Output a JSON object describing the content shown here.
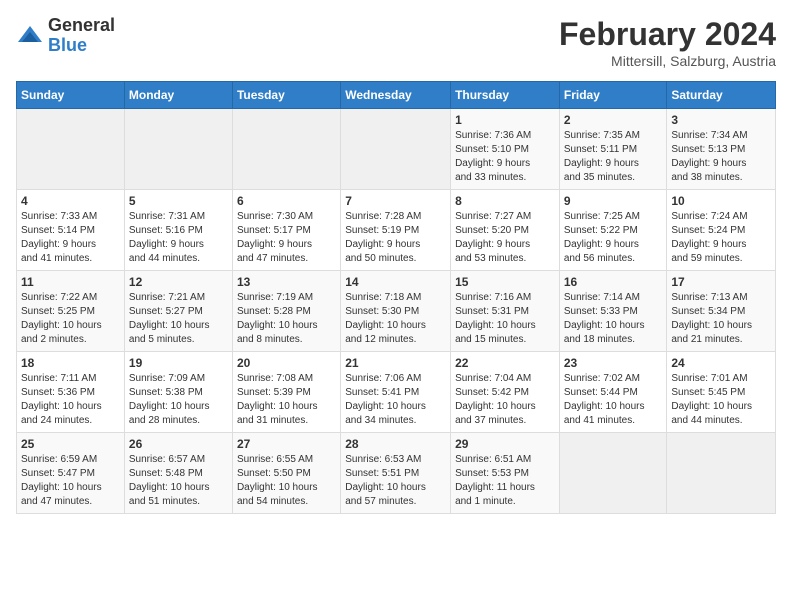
{
  "header": {
    "logo_general": "General",
    "logo_blue": "Blue",
    "month": "February 2024",
    "location": "Mittersill, Salzburg, Austria"
  },
  "days_of_week": [
    "Sunday",
    "Monday",
    "Tuesday",
    "Wednesday",
    "Thursday",
    "Friday",
    "Saturday"
  ],
  "weeks": [
    [
      {
        "day": "",
        "info": ""
      },
      {
        "day": "",
        "info": ""
      },
      {
        "day": "",
        "info": ""
      },
      {
        "day": "",
        "info": ""
      },
      {
        "day": "1",
        "info": "Sunrise: 7:36 AM\nSunset: 5:10 PM\nDaylight: 9 hours\nand 33 minutes."
      },
      {
        "day": "2",
        "info": "Sunrise: 7:35 AM\nSunset: 5:11 PM\nDaylight: 9 hours\nand 35 minutes."
      },
      {
        "day": "3",
        "info": "Sunrise: 7:34 AM\nSunset: 5:13 PM\nDaylight: 9 hours\nand 38 minutes."
      }
    ],
    [
      {
        "day": "4",
        "info": "Sunrise: 7:33 AM\nSunset: 5:14 PM\nDaylight: 9 hours\nand 41 minutes."
      },
      {
        "day": "5",
        "info": "Sunrise: 7:31 AM\nSunset: 5:16 PM\nDaylight: 9 hours\nand 44 minutes."
      },
      {
        "day": "6",
        "info": "Sunrise: 7:30 AM\nSunset: 5:17 PM\nDaylight: 9 hours\nand 47 minutes."
      },
      {
        "day": "7",
        "info": "Sunrise: 7:28 AM\nSunset: 5:19 PM\nDaylight: 9 hours\nand 50 minutes."
      },
      {
        "day": "8",
        "info": "Sunrise: 7:27 AM\nSunset: 5:20 PM\nDaylight: 9 hours\nand 53 minutes."
      },
      {
        "day": "9",
        "info": "Sunrise: 7:25 AM\nSunset: 5:22 PM\nDaylight: 9 hours\nand 56 minutes."
      },
      {
        "day": "10",
        "info": "Sunrise: 7:24 AM\nSunset: 5:24 PM\nDaylight: 9 hours\nand 59 minutes."
      }
    ],
    [
      {
        "day": "11",
        "info": "Sunrise: 7:22 AM\nSunset: 5:25 PM\nDaylight: 10 hours\nand 2 minutes."
      },
      {
        "day": "12",
        "info": "Sunrise: 7:21 AM\nSunset: 5:27 PM\nDaylight: 10 hours\nand 5 minutes."
      },
      {
        "day": "13",
        "info": "Sunrise: 7:19 AM\nSunset: 5:28 PM\nDaylight: 10 hours\nand 8 minutes."
      },
      {
        "day": "14",
        "info": "Sunrise: 7:18 AM\nSunset: 5:30 PM\nDaylight: 10 hours\nand 12 minutes."
      },
      {
        "day": "15",
        "info": "Sunrise: 7:16 AM\nSunset: 5:31 PM\nDaylight: 10 hours\nand 15 minutes."
      },
      {
        "day": "16",
        "info": "Sunrise: 7:14 AM\nSunset: 5:33 PM\nDaylight: 10 hours\nand 18 minutes."
      },
      {
        "day": "17",
        "info": "Sunrise: 7:13 AM\nSunset: 5:34 PM\nDaylight: 10 hours\nand 21 minutes."
      }
    ],
    [
      {
        "day": "18",
        "info": "Sunrise: 7:11 AM\nSunset: 5:36 PM\nDaylight: 10 hours\nand 24 minutes."
      },
      {
        "day": "19",
        "info": "Sunrise: 7:09 AM\nSunset: 5:38 PM\nDaylight: 10 hours\nand 28 minutes."
      },
      {
        "day": "20",
        "info": "Sunrise: 7:08 AM\nSunset: 5:39 PM\nDaylight: 10 hours\nand 31 minutes."
      },
      {
        "day": "21",
        "info": "Sunrise: 7:06 AM\nSunset: 5:41 PM\nDaylight: 10 hours\nand 34 minutes."
      },
      {
        "day": "22",
        "info": "Sunrise: 7:04 AM\nSunset: 5:42 PM\nDaylight: 10 hours\nand 37 minutes."
      },
      {
        "day": "23",
        "info": "Sunrise: 7:02 AM\nSunset: 5:44 PM\nDaylight: 10 hours\nand 41 minutes."
      },
      {
        "day": "24",
        "info": "Sunrise: 7:01 AM\nSunset: 5:45 PM\nDaylight: 10 hours\nand 44 minutes."
      }
    ],
    [
      {
        "day": "25",
        "info": "Sunrise: 6:59 AM\nSunset: 5:47 PM\nDaylight: 10 hours\nand 47 minutes."
      },
      {
        "day": "26",
        "info": "Sunrise: 6:57 AM\nSunset: 5:48 PM\nDaylight: 10 hours\nand 51 minutes."
      },
      {
        "day": "27",
        "info": "Sunrise: 6:55 AM\nSunset: 5:50 PM\nDaylight: 10 hours\nand 54 minutes."
      },
      {
        "day": "28",
        "info": "Sunrise: 6:53 AM\nSunset: 5:51 PM\nDaylight: 10 hours\nand 57 minutes."
      },
      {
        "day": "29",
        "info": "Sunrise: 6:51 AM\nSunset: 5:53 PM\nDaylight: 11 hours\nand 1 minute."
      },
      {
        "day": "",
        "info": ""
      },
      {
        "day": "",
        "info": ""
      }
    ]
  ]
}
